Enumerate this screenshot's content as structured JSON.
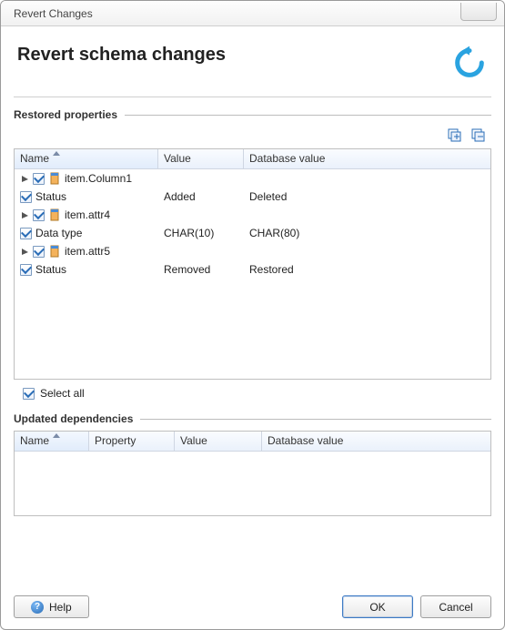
{
  "window": {
    "title": "Revert Changes"
  },
  "page": {
    "title": "Revert schema changes"
  },
  "restored": {
    "legend": "Restored properties",
    "columns": {
      "name": "Name",
      "value": "Value",
      "db": "Database value"
    },
    "rows": [
      {
        "kind": "group",
        "label": "item.Column1"
      },
      {
        "kind": "prop",
        "label": "Status",
        "value": "Added",
        "db": "Deleted"
      },
      {
        "kind": "group",
        "label": "item.attr4"
      },
      {
        "kind": "prop",
        "label": "Data type",
        "value": "CHAR(10)",
        "db": "CHAR(80)"
      },
      {
        "kind": "group",
        "label": "item.attr5"
      },
      {
        "kind": "prop",
        "label": "Status",
        "value": "Removed",
        "db": "Restored"
      }
    ],
    "select_all": "Select all"
  },
  "updated": {
    "legend": "Updated dependencies",
    "columns": {
      "name": "Name",
      "property": "Property",
      "value": "Value",
      "db": "Database value"
    }
  },
  "buttons": {
    "help": "Help",
    "ok": "OK",
    "cancel": "Cancel"
  }
}
